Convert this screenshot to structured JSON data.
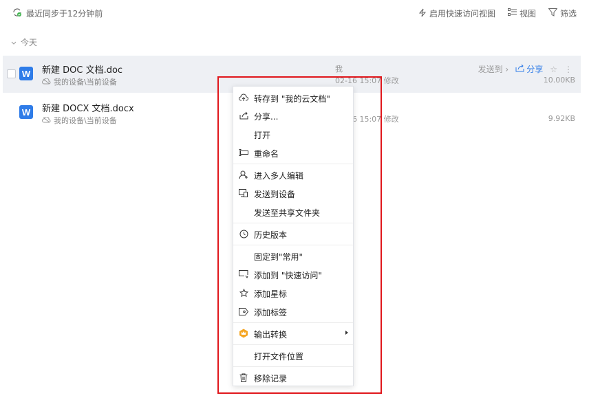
{
  "topbar": {
    "sync_text": "最近同步于12分钟前",
    "quick_access": "启用快速访问视图",
    "view": "视图",
    "filter": "筛选"
  },
  "group": {
    "label": "今天"
  },
  "files": [
    {
      "name": "新建 DOC 文档.doc",
      "location": "我的设备\\当前设备",
      "owner": "我",
      "modified": "02-16 15:07 修改",
      "send_to": "发送到",
      "share": "分享",
      "size": "10.00KB"
    },
    {
      "name": "新建 DOCX 文档.docx",
      "location": "我的设备\\当前设备",
      "modified": "02-16 15:07 修改",
      "size": "9.92KB"
    }
  ],
  "context_menu": {
    "save_to_cloud": "转存到 \"我的云文档\"",
    "share": "分享...",
    "open": "打开",
    "rename": "重命名",
    "multi_edit": "进入多人编辑",
    "send_to_device": "发送到设备",
    "send_to_shared": "发送至共享文件夹",
    "history": "历史版本",
    "pin": "固定到\"常用\"",
    "add_quick": "添加到 \"快速访问\"",
    "add_star": "添加星标",
    "add_tag": "添加标签",
    "export": "输出转换",
    "open_location": "打开文件位置",
    "remove": "移除记录"
  },
  "colors": {
    "accent": "#2f7ce8",
    "highlight": "#e0161b",
    "selected_row": "#eef0f4"
  }
}
